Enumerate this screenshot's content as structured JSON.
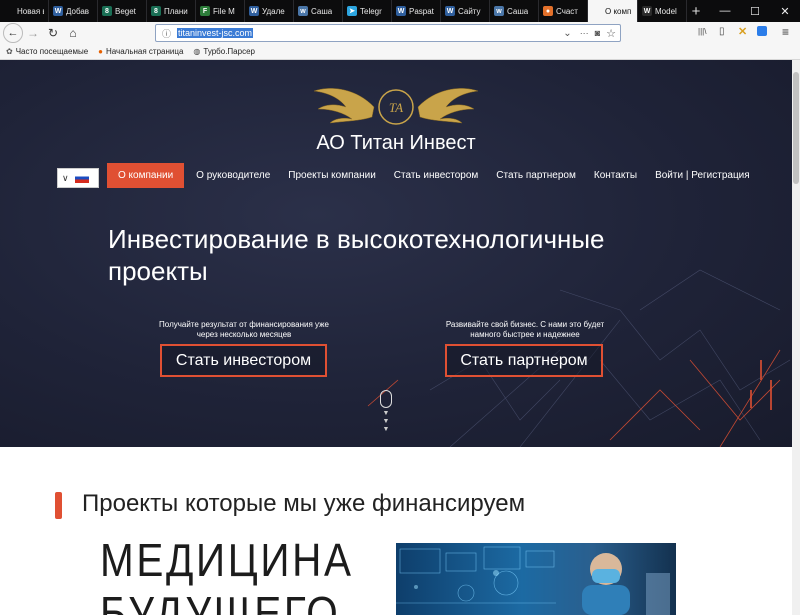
{
  "tabs": [
    {
      "label": "Новая вкл",
      "icon_name": "firefox-tab-icon",
      "color": "#0c0c0d",
      "glyph": ""
    },
    {
      "label": "Добав",
      "icon_name": "vk-icon",
      "color": "#2f5f9e",
      "glyph": "W"
    },
    {
      "label": "Beget",
      "icon_name": "beget-icon",
      "color": "#1a6f55",
      "glyph": "8"
    },
    {
      "label": "Плани",
      "icon_name": "beget-icon",
      "color": "#1a6f55",
      "glyph": "8"
    },
    {
      "label": "File M",
      "icon_name": "file-manager-icon",
      "color": "#2d7d3a",
      "glyph": "F"
    },
    {
      "label": "Удале",
      "icon_name": "vk-icon",
      "color": "#2f5f9e",
      "glyph": "W"
    },
    {
      "label": "Саша",
      "icon_name": "vk-icon",
      "color": "#4a76a8",
      "glyph": "w"
    },
    {
      "label": "Telegr",
      "icon_name": "telegram-icon",
      "color": "#2ca5e0",
      "glyph": "➤"
    },
    {
      "label": "Paspat",
      "icon_name": "vk-icon",
      "color": "#2f5f9e",
      "glyph": "W"
    },
    {
      "label": "Сайту",
      "icon_name": "vk-icon",
      "color": "#2f5f9e",
      "glyph": "W"
    },
    {
      "label": "Саша",
      "icon_name": "vk-icon",
      "color": "#4a76a8",
      "glyph": "w"
    },
    {
      "label": "Счаст",
      "icon_name": "pizza-icon",
      "color": "#e3702a",
      "glyph": "●"
    },
    {
      "label": "О комп",
      "icon_name": "site-tab-icon",
      "color": "#f6f6f6",
      "glyph": ""
    },
    {
      "label": "Model",
      "icon_name": "wix-icon",
      "color": "#2b2b2b",
      "glyph": "W"
    }
  ],
  "window_controls": {
    "minimize": "—",
    "maximize": "☐",
    "close": "✕"
  },
  "nav": {
    "back": "←",
    "forward": "→",
    "reload": "↻",
    "home": "⌂",
    "url": "titaninvest-jsc.com",
    "info": "ⓘ",
    "dropdown": "⌄",
    "more": "···",
    "pocket": "◙",
    "star": "☆",
    "library": "|||\\",
    "sidebar": "▯",
    "menu": "≡"
  },
  "bookmarks": [
    {
      "label": "Часто посещаемые",
      "icon": "gear-icon",
      "glyph": "✿"
    },
    {
      "label": "Начальная страница",
      "icon": "firefox-icon",
      "glyph": "●"
    },
    {
      "label": "Турбо.Парсер",
      "icon": "globe-icon",
      "glyph": "◍"
    }
  ],
  "site": {
    "brand": "АО Титан Инвест",
    "logo_letters": "TA",
    "menu": [
      "О компании",
      "О руководителе",
      "Проекты компании",
      "Стать инвестором",
      "Стать партнером",
      "Контакты",
      "Войти | Регистрация"
    ],
    "headline": "Инвестирование в высокотехнологичные проекты",
    "investor_text": "Получайте результат от финансирования уже через несколько месяцев",
    "investor_button": "Стать инвестором",
    "partner_text": "Развивайте свой бизнес. С нами это будет намного быстрее и надежнее",
    "partner_button": "Стать партнером",
    "section_title": "Проекты которые мы уже финансируем",
    "medicine_line1": "МЕДИЦИНА",
    "medicine_line2": "БУДУЩЕГО"
  },
  "colors": {
    "accent": "#e05033",
    "hero_bg": "#1f2338",
    "gold": "#c9a44a"
  }
}
